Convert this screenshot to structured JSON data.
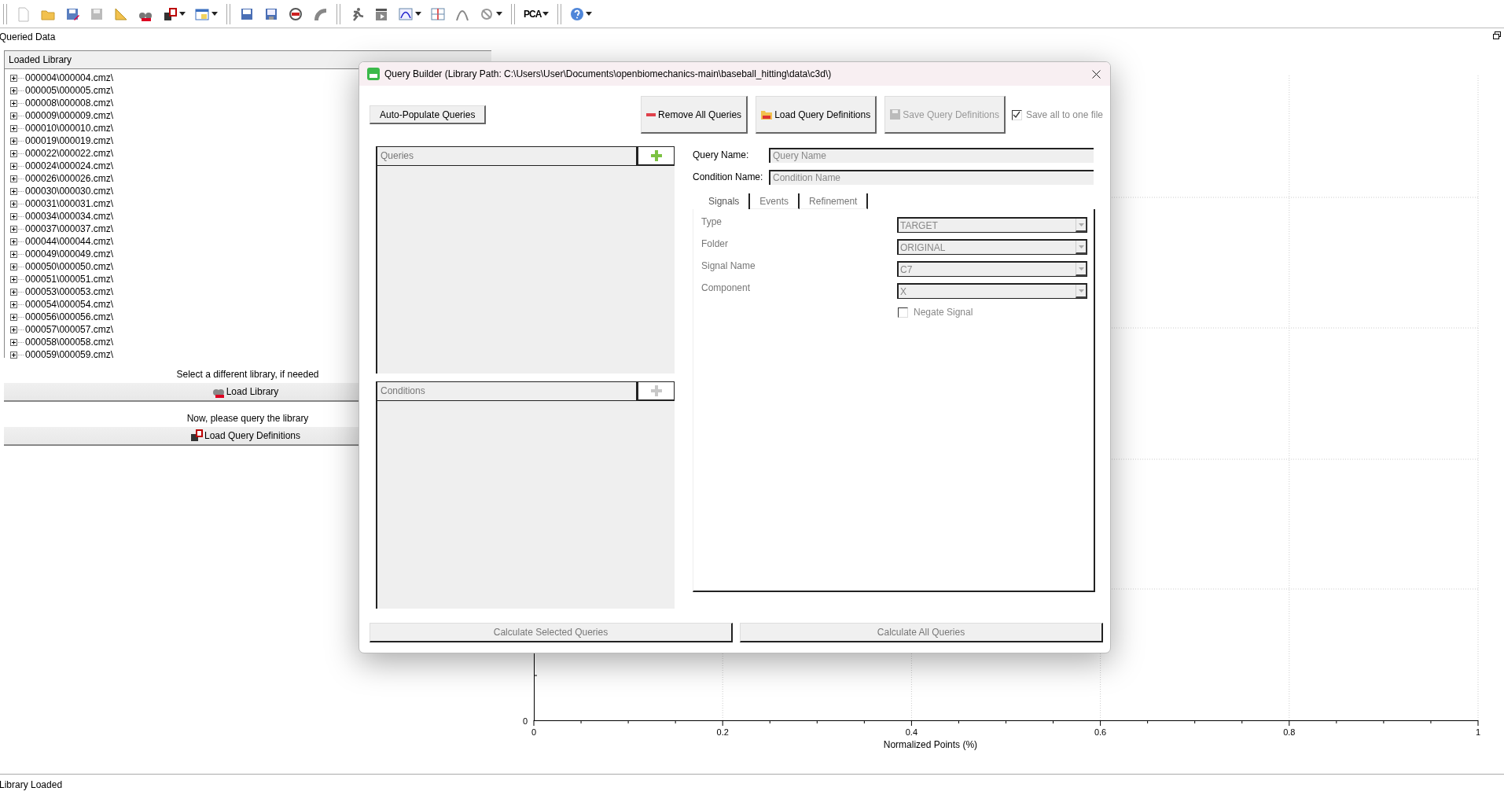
{
  "toolbar": {
    "pca_label": "PCA"
  },
  "panel_title": "Queried Data",
  "library": {
    "header": "Loaded Library",
    "items": [
      {
        "label": "000004\\000004.cmz\\",
        "expanded": false
      },
      {
        "label": "000005\\000005.cmz\\",
        "expanded": false
      },
      {
        "label": "000008\\000008.cmz\\",
        "expanded": false
      },
      {
        "label": "000009\\000009.cmz\\",
        "expanded": false
      },
      {
        "label": "000010\\000010.cmz\\",
        "expanded": false
      },
      {
        "label": "000019\\000019.cmz\\",
        "expanded": false
      },
      {
        "label": "000022\\000022.cmz\\",
        "expanded": false
      },
      {
        "label": "000024\\000024.cmz\\",
        "expanded": false
      },
      {
        "label": "000026\\000026.cmz\\",
        "expanded": false
      },
      {
        "label": "000030\\000030.cmz\\",
        "expanded": false
      },
      {
        "label": "000031\\000031.cmz\\",
        "expanded": false
      },
      {
        "label": "000034\\000034.cmz\\",
        "expanded": false
      },
      {
        "label": "000037\\000037.cmz\\",
        "expanded": false
      },
      {
        "label": "000044\\000044.cmz\\",
        "expanded": false
      },
      {
        "label": "000049\\000049.cmz\\",
        "expanded": false
      },
      {
        "label": "000050\\000050.cmz\\",
        "expanded": false
      },
      {
        "label": "000051\\000051.cmz\\",
        "expanded": false
      },
      {
        "label": "000053\\000053.cmz\\",
        "expanded": false
      },
      {
        "label": "000054\\000054.cmz\\",
        "expanded": false
      },
      {
        "label": "000056\\000056.cmz\\",
        "expanded": false
      },
      {
        "label": "000057\\000057.cmz\\",
        "expanded": false
      },
      {
        "label": "000058\\000058.cmz\\",
        "expanded": false
      },
      {
        "label": "000059\\000059.cmz\\",
        "expanded": false
      }
    ]
  },
  "hint_1": "Select a different library, if needed",
  "load_library_button": "Load Library",
  "hint_2": "Now, please query the library",
  "load_query_button": "Load Query Definitions",
  "chart": {
    "x_ticks": [
      "0",
      "0.2",
      "0.4",
      "0.6",
      "0.8",
      "1"
    ],
    "y_ticks": [
      "0"
    ],
    "x_title": "Normalized Points (%)"
  },
  "status_bar": "Library Loaded",
  "dialog": {
    "title": "Query Builder (Library Path: C:\\Users\\User\\Documents\\openbiomechanics-main\\baseball_hitting\\data\\c3d\\)",
    "buttons": [
      {
        "kind": "plain",
        "label": "Auto-Populate Queries",
        "disabled": false
      },
      {
        "kind": "remove",
        "label": "Remove All Queries",
        "disabled": false
      },
      {
        "kind": "load",
        "label": "Load Query Definitions",
        "disabled": false
      },
      {
        "kind": "save",
        "label": "Save Query Definitions",
        "disabled": true
      }
    ],
    "save_all": {
      "label": "Save all to one file",
      "checked": true
    },
    "queries": {
      "header": "Queries",
      "add_disabled": false
    },
    "conditions": {
      "header": "Conditions",
      "add_disabled": true
    },
    "query_name": {
      "label": "Query Name:",
      "placeholder": "Query Name"
    },
    "condition_name": {
      "label": "Condition Name:",
      "placeholder": "Condition Name"
    },
    "tabs": [
      {
        "label": "Signals",
        "selected": true
      },
      {
        "label": "Events",
        "selected": false
      },
      {
        "label": "Refinement",
        "selected": false
      }
    ],
    "fields": [
      {
        "label": "Type",
        "value": "TARGET"
      },
      {
        "label": "Folder",
        "value": "ORIGINAL"
      },
      {
        "label": "Signal Name",
        "value": "C7"
      },
      {
        "label": "Component",
        "value": "X"
      }
    ],
    "negate": {
      "label": "Negate Signal",
      "checked": false
    },
    "calc_buttons": [
      {
        "label": "Calculate Selected Queries",
        "disabled": true
      },
      {
        "label": "Calculate All Queries",
        "disabled": true
      }
    ]
  }
}
